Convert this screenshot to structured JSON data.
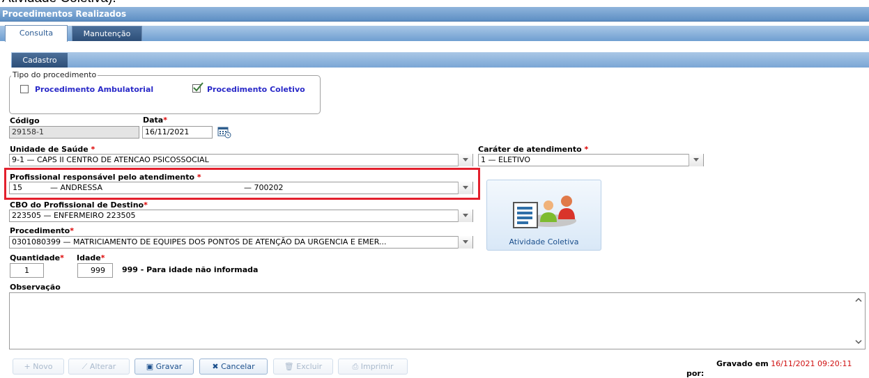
{
  "top_caption": "Atividade Coletiva).",
  "window": {
    "title": "Procedimentos Realizados"
  },
  "tabs": [
    {
      "label": "Consulta"
    },
    {
      "label": "Manutenção"
    }
  ],
  "subtab": {
    "label": "Cadastro"
  },
  "tipo": {
    "legend": "Tipo do procedimento",
    "ambulatorial": {
      "label": "Procedimento Ambulatorial",
      "checked": false
    },
    "coletivo": {
      "label": "Procedimento Coletivo",
      "checked": true
    }
  },
  "codigo": {
    "label": "Código",
    "value": "29158-1"
  },
  "data": {
    "label": "Data",
    "value": "16/11/2021"
  },
  "unidade": {
    "label": "Unidade de Saúde",
    "value": "9-1 — CAPS II CENTRO DE ATENCAO PSICOSSOCIAL"
  },
  "carater": {
    "label": "Caráter de atendimento",
    "value": "1 — ELETIVO"
  },
  "profissional": {
    "label": "Profissional responsável pelo atendimento",
    "code": "15",
    "name": "— ANDRESSA",
    "reg": "— 700202"
  },
  "cbo": {
    "label": "CBO do Profissional de Destino",
    "value": "223505 — ENFERMEIRO 223505"
  },
  "procedimento": {
    "label": "Procedimento",
    "value": "0301080399 — MATRICIAMENTO DE EQUIPES DOS PONTOS DE ATENÇÃO DA URGENCIA E EMER..."
  },
  "atividade": {
    "label": "Atividade Coletiva"
  },
  "quantidade": {
    "label": "Quantidade",
    "value": "1"
  },
  "idade": {
    "label": "Idade",
    "value": "999",
    "hint": "999 - Para idade não informada"
  },
  "observacao": {
    "label": "Observação",
    "value": ""
  },
  "toolbar": {
    "novo": "+ Novo",
    "alterar": "Alterar",
    "gravar": "Gravar",
    "cancelar": "Cancelar",
    "excluir": "Excluir",
    "imprimir": "Imprimir"
  },
  "saved": {
    "prefix": "Gravado em",
    "datetime": "16/11/2021 09:20:11",
    "por": "por:"
  },
  "colors": {
    "title_bar": "#5e8fc4",
    "required": "#dd0000",
    "highlight": "#e3202d",
    "link_label": "#2a2ac8"
  }
}
